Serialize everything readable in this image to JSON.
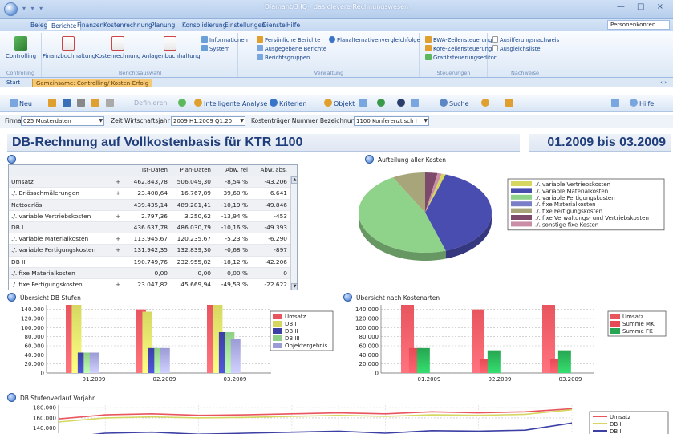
{
  "window": {
    "title": "Diamant/3 IQ - das clevere Rechnungswesen",
    "quick_access": "▾ ▾ ▾",
    "controls": "— □ ×"
  },
  "menu": {
    "items": [
      "Belege",
      "Berichte",
      "Finanzen",
      "Kostenrechnung",
      "Planung",
      "Konsolidierung",
      "Einstellungen",
      "Dienste",
      "Hilfe"
    ],
    "active_index": 1,
    "right_box": "Personenkonten"
  },
  "ribbon": {
    "groups": [
      {
        "label": "Controlling",
        "buttons": [
          "Controlling"
        ]
      },
      {
        "label": "Berichtsauswahl",
        "buttons": [
          "Finanzbuchhaltung",
          "Kostenrechnung",
          "Anlagenbuchhaltung"
        ],
        "small": [
          "Informationen",
          "System"
        ]
      },
      {
        "label": "Verwaltung",
        "small": [
          "Persönliche Berichte",
          "Planalternativenvergleichfolge",
          "Ausgegebene Berichte",
          "Berichtsgruppen"
        ]
      },
      {
        "label": "Steuerungen",
        "small": [
          "BWA-Zeilensteuerung",
          "Kore-Zeilensteuerung",
          "Grafiksteuerungseditor"
        ]
      },
      {
        "label": "Nachweise",
        "small": [
          "Ausifferungsnachweis",
          "Ausgleichsliste"
        ]
      }
    ]
  },
  "doc_tabs": {
    "start": "Start",
    "active": "Gemeinsame: Controlling/ Kosten-Erfolg",
    "right": "‹ ›"
  },
  "toolbar": {
    "items": [
      "Neu",
      "Definieren",
      "Intelligente Analyse",
      "Kriterien",
      "Objekt",
      "Suche",
      "Hilfe"
    ]
  },
  "filters": {
    "firma_label": "Firma",
    "firma_value": "025 Musterdaten",
    "zeit_label": "Zeit Wirtschaftsjahr",
    "zeit_value": "2009 H1.2009 Q1.20",
    "ktr_label": "Kostenträger Nummer Bezeichnung",
    "ktr_value": "1100 Konferenztisch I"
  },
  "report": {
    "title": "DB-Rechnung auf Vollkostenbasis für KTR 1100",
    "period": "01.2009 bis 03.2009"
  },
  "table": {
    "headers": [
      "",
      "Ist-Daten",
      "Plan-Daten",
      "Abw. rel",
      "Abw. abs."
    ],
    "rows": [
      {
        "label": "Umsatz",
        "plus": "+",
        "ist": "462.843,78",
        "plan": "506.049,30",
        "rel": "-8,54 %",
        "abs": "-43.206",
        "shade": true
      },
      {
        "label": "./. Erlösschmälerungen",
        "plus": "+",
        "ist": "23.408,64",
        "plan": "16.767,89",
        "rel": "39,60 %",
        "abs": "6.641",
        "shade": false
      },
      {
        "label": "Nettoerlös",
        "plus": "",
        "ist": "439.435,14",
        "plan": "489.281,41",
        "rel": "-10,19 %",
        "abs": "-49.846",
        "shade": true
      },
      {
        "label": "./. variable Vertriebskosten",
        "plus": "+",
        "ist": "2.797,36",
        "plan": "3.250,62",
        "rel": "-13,94 %",
        "abs": "-453",
        "shade": false
      },
      {
        "label": "DB I",
        "plus": "",
        "ist": "436.637,78",
        "plan": "486.030,79",
        "rel": "-10,16 %",
        "abs": "-49.393",
        "shade": true
      },
      {
        "label": "./. variable Materialkosten",
        "plus": "+",
        "ist": "113.945,67",
        "plan": "120.235,67",
        "rel": "-5,23 %",
        "abs": "-6.290",
        "shade": false
      },
      {
        "label": "./. variable Fertigungskosten",
        "plus": "+",
        "ist": "131.942,35",
        "plan": "132.839,30",
        "rel": "-0,68 %",
        "abs": "-897",
        "shade": true
      },
      {
        "label": "DB II",
        "plus": "",
        "ist": "190.749,76",
        "plan": "232.955,82",
        "rel": "-18,12 %",
        "abs": "-42.206",
        "shade": false
      },
      {
        "label": "./. fixe Materialkosten",
        "plus": "",
        "ist": "0,00",
        "plan": "0,00",
        "rel": "0,00 %",
        "abs": "0",
        "shade": true
      },
      {
        "label": "./. fixe Fertigungskosten",
        "plus": "+",
        "ist": "23.047,82",
        "plan": "45.669,94",
        "rel": "-49,53 %",
        "abs": "-22.622",
        "shade": false
      }
    ]
  },
  "sections": {
    "pie_title": "Aufteilung aller Kosten",
    "db_title": "Übersicht DB Stufen",
    "ka_title": "Übersicht nach Kostenarten",
    "vorjahr_title": "DB Stufenverlauf Vorjahr"
  },
  "colors": {
    "header_text": "#1f3d7a",
    "ribbon_text": "#15428b",
    "umsatz": "#e8555e",
    "db1": "#d5d760",
    "db2": "#3c3fa4",
    "db3": "#8fcf86",
    "objektergebnis": "#9b9bd6",
    "summe_mk": "#e84a55",
    "summe_fk": "#27a552"
  },
  "chart_data": [
    {
      "type": "pie",
      "title": "Aufteilung aller Kosten",
      "slices": [
        {
          "name": "./. variable Vertriebskosten",
          "value": 1,
          "color": "#d5d760"
        },
        {
          "name": "./. variable Materialkosten",
          "value": 40,
          "color": "#4a4db0"
        },
        {
          "name": "./. variable Fertigungskosten",
          "value": 47,
          "color": "#8fd28a"
        },
        {
          "name": "./. fixe Materialkosten",
          "value": 0,
          "color": "#7b7fc8"
        },
        {
          "name": "./. fixe Fertigungskosten",
          "value": 8,
          "color": "#a8a57a"
        },
        {
          "name": "./. fixe Verwaltungs- und Vertriebskosten",
          "value": 3,
          "color": "#7d4a6b"
        },
        {
          "name": "./. sonstige fixe Kosten",
          "value": 1,
          "color": "#c98ea6"
        }
      ],
      "legend_position": "right"
    },
    {
      "type": "bar",
      "title": "Übersicht DB Stufen",
      "categories": [
        "01.2009",
        "02.2009",
        "03.2009"
      ],
      "series": [
        {
          "name": "Umsatz",
          "values": [
            165000,
            140000,
            165000
          ],
          "color": "#e8555e"
        },
        {
          "name": "DB I",
          "values": [
            160000,
            135000,
            160000
          ],
          "color": "#d5d760"
        },
        {
          "name": "DB II",
          "values": [
            45000,
            55000,
            90000
          ],
          "color": "#3c3fa4"
        },
        {
          "name": "DB III",
          "values": [
            45000,
            55000,
            90000
          ],
          "color": "#8fcf86"
        },
        {
          "name": "Objektergebnis",
          "values": [
            45000,
            55000,
            75000
          ],
          "color": "#9b9bd6"
        }
      ],
      "yticks": [
        "140.000",
        "120.000",
        "100.000",
        "80.000",
        "60.000",
        "40.000",
        "20.000",
        "0"
      ],
      "ylim": [
        0,
        150000
      ],
      "grid": true,
      "legend_position": "right"
    },
    {
      "type": "bar",
      "title": "Übersicht nach Kostenarten",
      "categories": [
        "01.2009",
        "02.2009",
        "03.2009"
      ],
      "series": [
        {
          "name": "Umsatz",
          "values": [
            165000,
            140000,
            165000
          ],
          "color": "#e8555e"
        },
        {
          "name": "Summe MK",
          "values": [
            55000,
            30000,
            30000
          ],
          "color": "#e84a55"
        },
        {
          "name": "Summe FK",
          "values": [
            55000,
            50000,
            50000
          ],
          "color": "#27a552"
        }
      ],
      "yticks": [
        "140.000",
        "120.000",
        "100.000",
        "80.000",
        "60.000",
        "40.000",
        "20.000",
        "0"
      ],
      "ylim": [
        0,
        150000
      ],
      "grid": true,
      "legend_position": "right"
    },
    {
      "type": "line",
      "title": "DB Stufenverlauf Vorjahr",
      "yticks": [
        "180.000",
        "160.000",
        "140.000"
      ],
      "series": [
        {
          "name": "Umsatz",
          "values": [
            158000,
            166000,
            168000,
            165000,
            166000,
            168000,
            170000,
            168000,
            172000,
            170000,
            172000,
            178000
          ],
          "color": "#e8555e"
        },
        {
          "name": "DB I",
          "values": [
            152000,
            160000,
            162000,
            160000,
            161000,
            163000,
            165000,
            163000,
            166000,
            165000,
            167000,
            176000
          ],
          "color": "#d5d760"
        },
        {
          "name": "DB II",
          "values": [
            120000,
            130000,
            132000,
            128000,
            130000,
            132000,
            134000,
            130000,
            135000,
            134000,
            136000,
            150000
          ],
          "color": "#3c3fa4"
        }
      ],
      "ylim": [
        130000,
        185000
      ],
      "grid": true,
      "legend_position": "right"
    }
  ]
}
